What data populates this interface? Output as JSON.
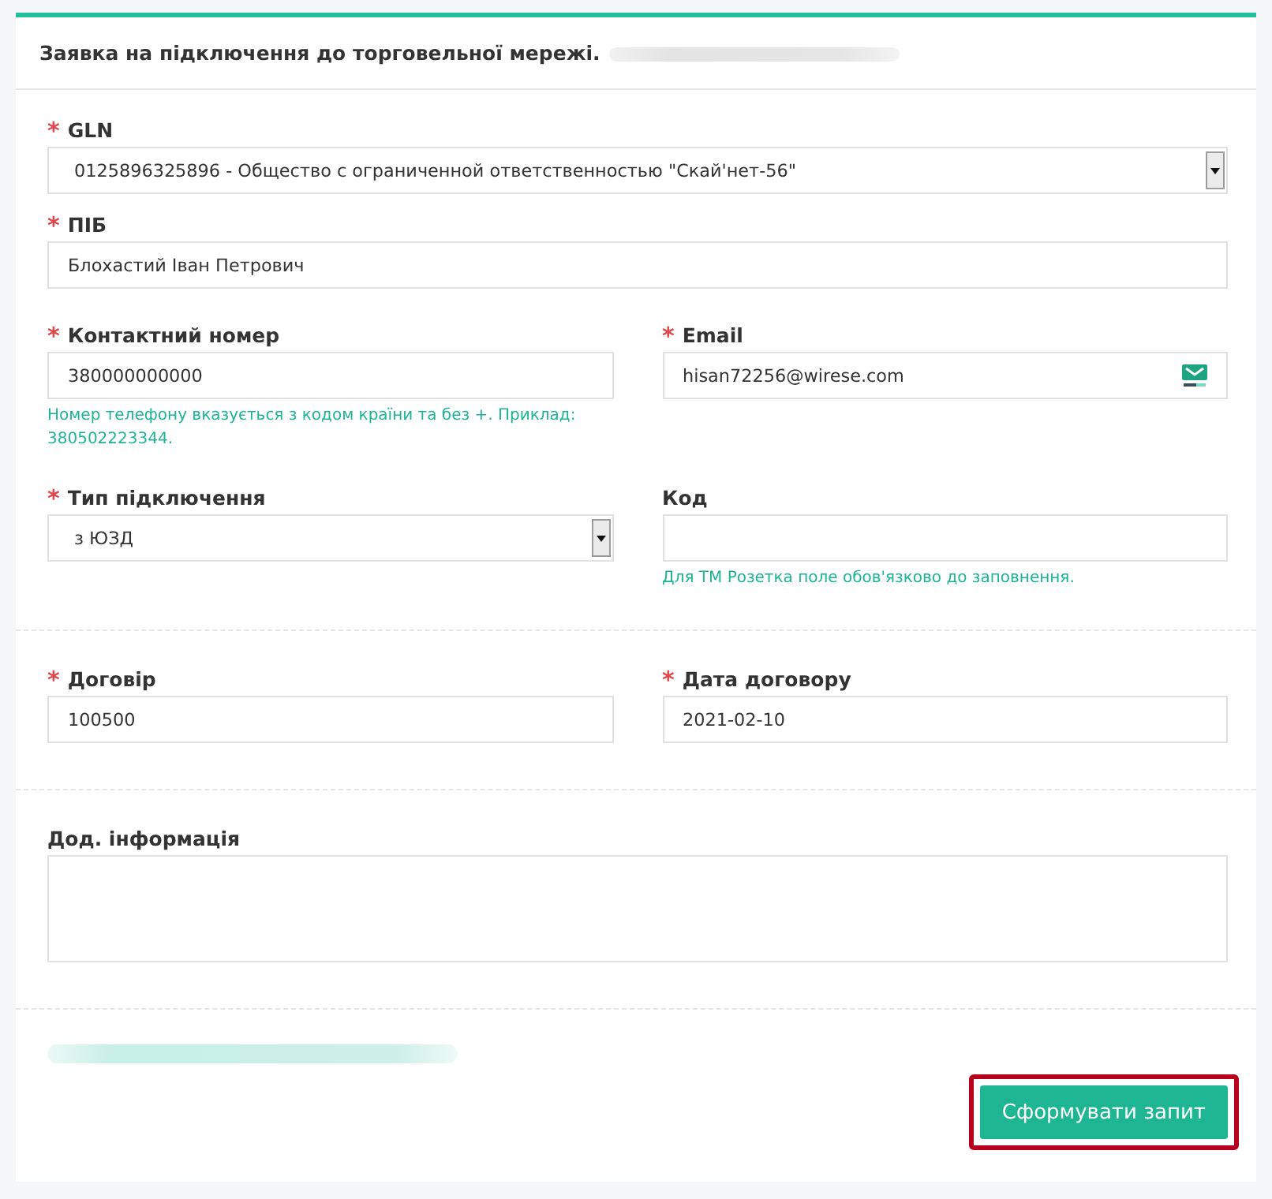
{
  "header": {
    "title": "Заявка на підключення до торговельної мережі.",
    "blurred_note": true
  },
  "sections": [
    {
      "rows": [
        [
          {
            "kind": "select",
            "label": "GLN",
            "required_mark": "*",
            "value": "0125896325896 - Общество с ограниченной ответственностью \"Скай'нет-56\""
          }
        ],
        [
          {
            "kind": "text",
            "label": "ПІБ",
            "required_mark": "*",
            "value": "Блохастий Іван Петрович"
          }
        ],
        [
          {
            "kind": "text",
            "label": "Контактний номер",
            "required_mark": "*",
            "value": "380000000000",
            "hint": "Номер телефону вказується з кодом країни та без +. Приклад: 380502223344."
          },
          {
            "kind": "email",
            "label": "Email",
            "required_mark": "*",
            "value": "hisan72256@wirese.com"
          }
        ],
        [
          {
            "kind": "select",
            "label": "Тип підключення",
            "required_mark": "*",
            "value": "з ЮЗД"
          },
          {
            "kind": "text",
            "label": "Код",
            "hint": "Для ТМ Розетка поле обов'язково до заповнення."
          }
        ]
      ]
    },
    {
      "rows": [
        [
          {
            "kind": "text",
            "label": "Договір",
            "required_mark": "*",
            "value": "100500"
          },
          {
            "kind": "text",
            "label": "Дата договору",
            "required_mark": "*",
            "value": "2021-02-10"
          }
        ]
      ]
    },
    {
      "rows": [
        [
          {
            "kind": "textarea",
            "label": "Дод. інформація"
          }
        ]
      ]
    }
  ],
  "footer": {
    "blurred_link": true,
    "submit_button": {
      "label": "Сформувати запит",
      "highlighted": true
    }
  }
}
